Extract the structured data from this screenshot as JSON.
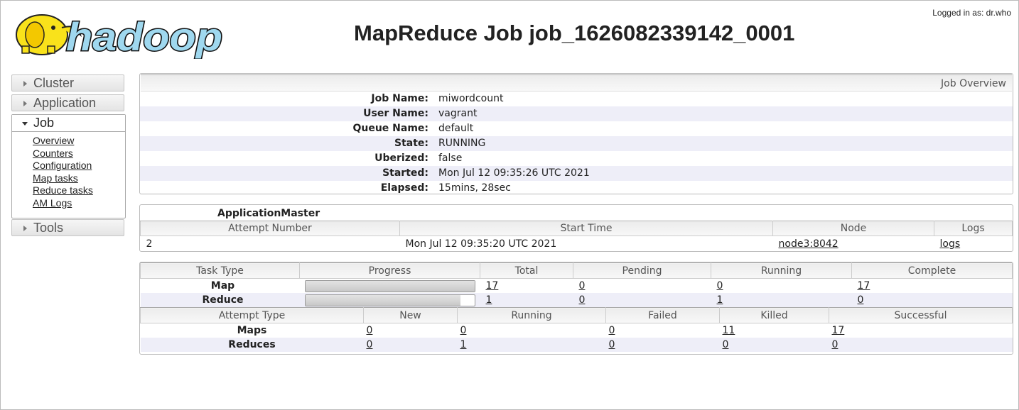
{
  "header": {
    "logo_text": "hadoop",
    "title": "MapReduce Job job_1626082339142_0001",
    "login": "Logged in as: dr.who"
  },
  "sidebar": {
    "sections": [
      {
        "label": "Cluster",
        "expanded": false
      },
      {
        "label": "Application",
        "expanded": false
      },
      {
        "label": "Job",
        "expanded": true,
        "links": [
          "Overview",
          "Counters",
          "Configuration",
          "Map tasks",
          "Reduce tasks",
          "AM Logs"
        ]
      },
      {
        "label": "Tools",
        "expanded": false
      }
    ]
  },
  "overview": {
    "heading": "Job Overview",
    "rows": [
      {
        "key": "Job Name:",
        "value": "miwordcount"
      },
      {
        "key": "User Name:",
        "value": "vagrant"
      },
      {
        "key": "Queue Name:",
        "value": "default"
      },
      {
        "key": "State:",
        "value": "RUNNING"
      },
      {
        "key": "Uberized:",
        "value": "false"
      },
      {
        "key": "Started:",
        "value": "Mon Jul 12 09:35:26 UTC 2021"
      },
      {
        "key": "Elapsed:",
        "value": "15mins, 28sec"
      }
    ]
  },
  "application_master": {
    "title": "ApplicationMaster",
    "columns": [
      "Attempt Number",
      "Start Time",
      "Node",
      "Logs"
    ],
    "row": {
      "attempt": "2",
      "start_time": "Mon Jul 12 09:35:20 UTC 2021",
      "node": "node3:8042",
      "logs": "logs"
    }
  },
  "tasks": {
    "columns": [
      "Task Type",
      "Progress",
      "Total",
      "Pending",
      "Running",
      "Complete"
    ],
    "rows": [
      {
        "type": "Map",
        "progress": 1.0,
        "total": "17",
        "pending": "0",
        "running": "0",
        "complete": "17"
      },
      {
        "type": "Reduce",
        "progress": 0.92,
        "total": "1",
        "pending": "0",
        "running": "1",
        "complete": "0"
      }
    ]
  },
  "attempts": {
    "columns": [
      "Attempt Type",
      "New",
      "Running",
      "Failed",
      "Killed",
      "Successful"
    ],
    "rows": [
      {
        "type": "Maps",
        "new": "0",
        "running": "0",
        "failed": "0",
        "killed": "11",
        "successful": "17"
      },
      {
        "type": "Reduces",
        "new": "0",
        "running": "1",
        "failed": "0",
        "killed": "0",
        "successful": "0"
      }
    ]
  },
  "colors": {
    "alt_row": "#eeeef8",
    "logo_blue": "#9fd8ef",
    "logo_yellow": "#f9e21b"
  }
}
